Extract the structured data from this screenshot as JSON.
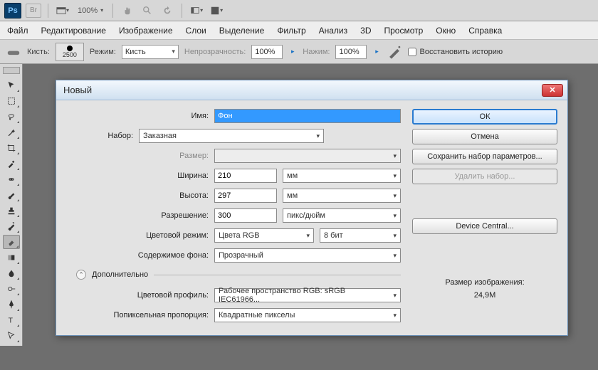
{
  "topbar": {
    "ps": "Ps",
    "br": "Br",
    "zoom": "100%"
  },
  "menu": {
    "file": "Файл",
    "edit": "Редактирование",
    "image": "Изображение",
    "layer": "Слои",
    "select": "Выделение",
    "filter": "Фильтр",
    "analysis": "Анализ",
    "3d": "3D",
    "view": "Просмотр",
    "window": "Окно",
    "help": "Справка"
  },
  "options": {
    "brush_label": "Кисть:",
    "brush_size": "2500",
    "mode_label": "Режим:",
    "mode_value": "Кисть",
    "opacity_label": "Непрозрачность:",
    "opacity_value": "100%",
    "pressure_label": "Нажим:",
    "pressure_value": "100%",
    "restore_hist": "Восстановить историю"
  },
  "dialog": {
    "title": "Новый",
    "name_label": "Имя:",
    "name_value": "Фон",
    "preset_label": "Набор:",
    "preset_value": "Заказная",
    "size_label": "Размер:",
    "width_label": "Ширина:",
    "width_value": "210",
    "width_unit": "мм",
    "height_label": "Высота:",
    "height_value": "297",
    "height_unit": "мм",
    "res_label": "Разрешение:",
    "res_value": "300",
    "res_unit": "пикс/дюйм",
    "colormode_label": "Цветовой режим:",
    "colormode_value": "Цвета RGB",
    "colordepth_value": "8 бит",
    "bgcontents_label": "Содержимое фона:",
    "bgcontents_value": "Прозрачный",
    "advanced_label": "Дополнительно",
    "colorprofile_label": "Цветовой профиль:",
    "colorprofile_value": "Рабочее пространство RGB: sRGB IEC61966...",
    "pixelratio_label": "Попиксельная пропорция:",
    "pixelratio_value": "Квадратные пикселы",
    "ok": "ОК",
    "cancel": "Отмена",
    "save_preset": "Сохранить набор параметров...",
    "delete_preset": "Удалить набор...",
    "device_central": "Device Central...",
    "imgsize_label": "Размер изображения:",
    "imgsize_value": "24,9M"
  }
}
